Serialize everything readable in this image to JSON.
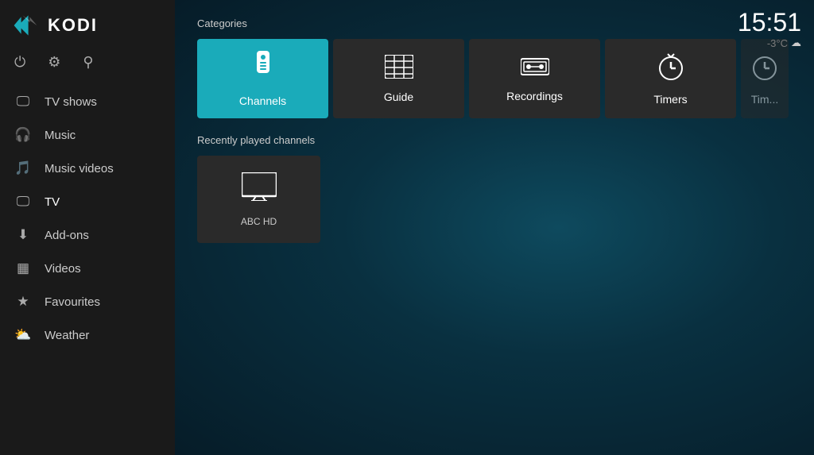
{
  "app": {
    "name": "KODI"
  },
  "clock": {
    "time": "15:51",
    "temperature": "-3°C",
    "weather_icon": "☁"
  },
  "sidebar": {
    "top_icons": [
      {
        "name": "power-icon",
        "glyph": "⏻",
        "label": "Power"
      },
      {
        "name": "settings-icon",
        "glyph": "⚙",
        "label": "Settings"
      },
      {
        "name": "search-icon",
        "glyph": "🔍",
        "label": "Search"
      }
    ],
    "items": [
      {
        "id": "tv-shows",
        "label": "TV shows",
        "icon": "🖥"
      },
      {
        "id": "music",
        "label": "Music",
        "icon": "🎧"
      },
      {
        "id": "music-videos",
        "label": "Music videos",
        "icon": "🎵"
      },
      {
        "id": "tv",
        "label": "TV",
        "icon": "📺",
        "active": true
      },
      {
        "id": "add-ons",
        "label": "Add-ons",
        "icon": "⬇"
      },
      {
        "id": "videos",
        "label": "Videos",
        "icon": "🎞"
      },
      {
        "id": "favourites",
        "label": "Favourites",
        "icon": "★"
      },
      {
        "id": "weather",
        "label": "Weather",
        "icon": "⛅"
      }
    ]
  },
  "main": {
    "categories_label": "Categories",
    "categories": [
      {
        "id": "channels",
        "label": "Channels",
        "icon": "remote",
        "active": true
      },
      {
        "id": "guide",
        "label": "Guide",
        "icon": "guide"
      },
      {
        "id": "recordings",
        "label": "Recordings",
        "icon": "recordings"
      },
      {
        "id": "timers",
        "label": "Timers",
        "icon": "timers"
      },
      {
        "id": "timers2",
        "label": "Tim...",
        "icon": "timers",
        "partial": true
      }
    ],
    "recently_played_label": "Recently played channels",
    "channels": [
      {
        "id": "abc-hd",
        "label": "ABC HD"
      }
    ]
  }
}
